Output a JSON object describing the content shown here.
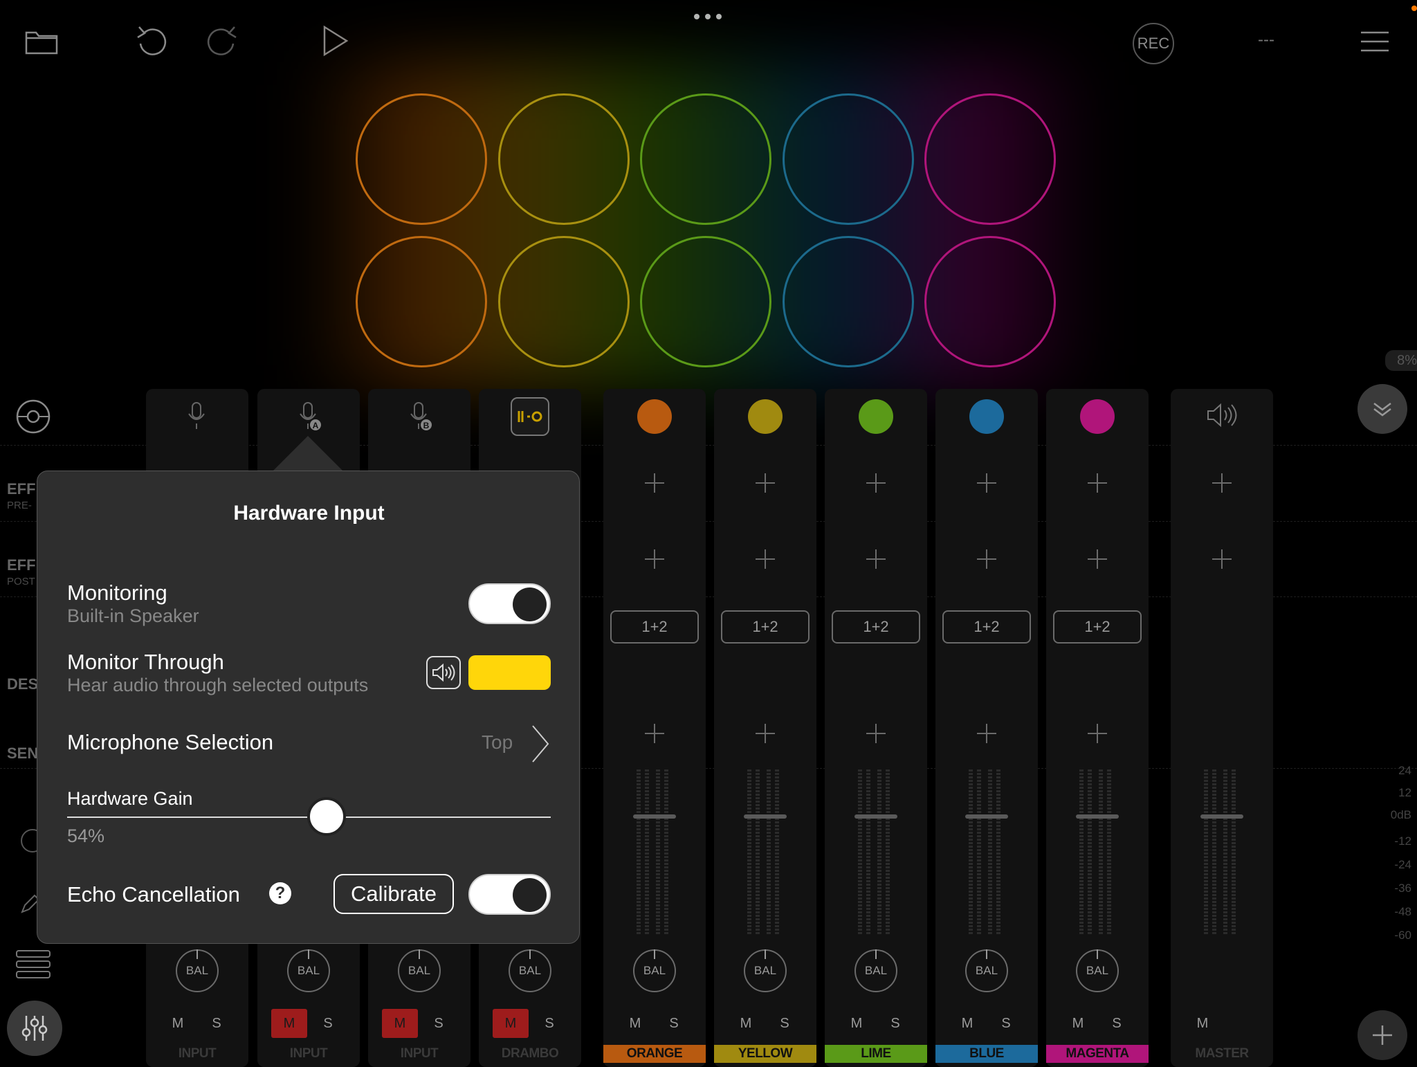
{
  "topbar": {
    "icons": [
      "folder-icon",
      "undo-icon",
      "redo-icon",
      "play-icon",
      "more-dots-icon",
      "menu-icon"
    ],
    "rec_label": "REC",
    "tempo": "---"
  },
  "cpu_badge": "8%",
  "left_labels": {
    "eff_pre": "EFF",
    "eff_pre_sub": "PRE-",
    "eff_post": "EFF",
    "eff_post_sub": "POST",
    "dest": "DES",
    "send": "SEN"
  },
  "pads": {
    "colors": [
      "#c06a10",
      "#a89010",
      "#5a9a18",
      "#1c6a8c",
      "#b0157a"
    ]
  },
  "channels": [
    {
      "name": "INPUT",
      "mute": "M",
      "solo": "S",
      "muted": false,
      "bal": "BAL"
    },
    {
      "name": "INPUT",
      "mute": "M",
      "solo": "S",
      "muted": true,
      "bal": "BAL"
    },
    {
      "name": "INPUT",
      "mute": "M",
      "solo": "S",
      "muted": true,
      "bal": "BAL"
    },
    {
      "name": "DRAMBO",
      "mute": "M",
      "solo": "S",
      "muted": true,
      "bal": "BAL"
    },
    {
      "name": "ORANGE",
      "mute": "M",
      "solo": "S",
      "bal": "BAL",
      "route": "1+2",
      "color": "#b85a10"
    },
    {
      "name": "YELLOW",
      "mute": "M",
      "solo": "S",
      "bal": "BAL",
      "route": "1+2",
      "color": "#a08a10"
    },
    {
      "name": "LIME",
      "mute": "M",
      "solo": "S",
      "bal": "BAL",
      "route": "1+2",
      "color": "#5a9a18"
    },
    {
      "name": "BLUE",
      "mute": "M",
      "solo": "S",
      "bal": "BAL",
      "route": "1+2",
      "color": "#1c6a9c"
    },
    {
      "name": "MAGENTA",
      "mute": "M",
      "solo": "S",
      "bal": "BAL",
      "route": "1+2",
      "color": "#b0157a"
    },
    {
      "name": "MASTER",
      "mute": "M"
    }
  ],
  "db_scale": [
    "24",
    "12",
    "0dB",
    "-12",
    "-24",
    "-36",
    "-48",
    "-60"
  ],
  "popover": {
    "title": "Hardware Input",
    "monitoring": {
      "label": "Monitoring",
      "sub": "Built-in Speaker",
      "on": true
    },
    "monitor_through": {
      "label": "Monitor Through",
      "sub": "Hear audio through selected outputs",
      "color": "#ffd60a"
    },
    "mic_selection": {
      "label": "Microphone Selection",
      "value": "Top"
    },
    "hardware_gain": {
      "label": "Hardware Gain",
      "value_text": "54%",
      "value": 0.54
    },
    "echo": {
      "label": "Echo Cancellation",
      "calibrate": "Calibrate",
      "on": true
    }
  }
}
